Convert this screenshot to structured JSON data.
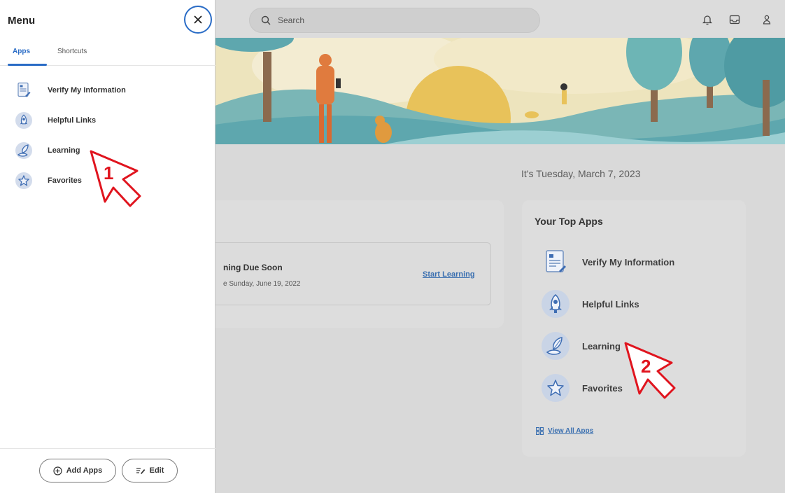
{
  "topbar": {
    "search_placeholder": "Search",
    "icons": [
      "bell-icon",
      "inbox-icon",
      "user-icon"
    ]
  },
  "home": {
    "date_text": "It's Tuesday, March 7, 2023",
    "learning_card": {
      "title": "ning Due Soon",
      "due_date": "e Sunday, June 19, 2022",
      "start_link": "Start Learning"
    },
    "top_apps": {
      "title": "Your Top Apps",
      "items": [
        {
          "label": "Verify My Information",
          "icon": "document-icon"
        },
        {
          "label": "Helpful Links",
          "icon": "rocket-icon"
        },
        {
          "label": "Learning",
          "icon": "learning-icon"
        },
        {
          "label": "Favorites",
          "icon": "star-icon"
        }
      ],
      "view_all": "View All Apps"
    }
  },
  "menu": {
    "title": "Menu",
    "tabs": [
      {
        "label": "Apps",
        "active": true
      },
      {
        "label": "Shortcuts",
        "active": false
      }
    ],
    "items": [
      {
        "label": "Verify My Information",
        "icon": "document-icon"
      },
      {
        "label": "Helpful Links",
        "icon": "rocket-icon"
      },
      {
        "label": "Learning",
        "icon": "learning-icon"
      },
      {
        "label": "Favorites",
        "icon": "star-icon"
      }
    ],
    "footer": {
      "add_apps": "Add Apps",
      "edit": "Edit"
    }
  },
  "annotations": {
    "arrow_1": "1",
    "arrow_2": "2"
  },
  "colors": {
    "accent": "#2a6cc6",
    "link": "#3a6fb0",
    "annotation_red": "#e0141e"
  }
}
